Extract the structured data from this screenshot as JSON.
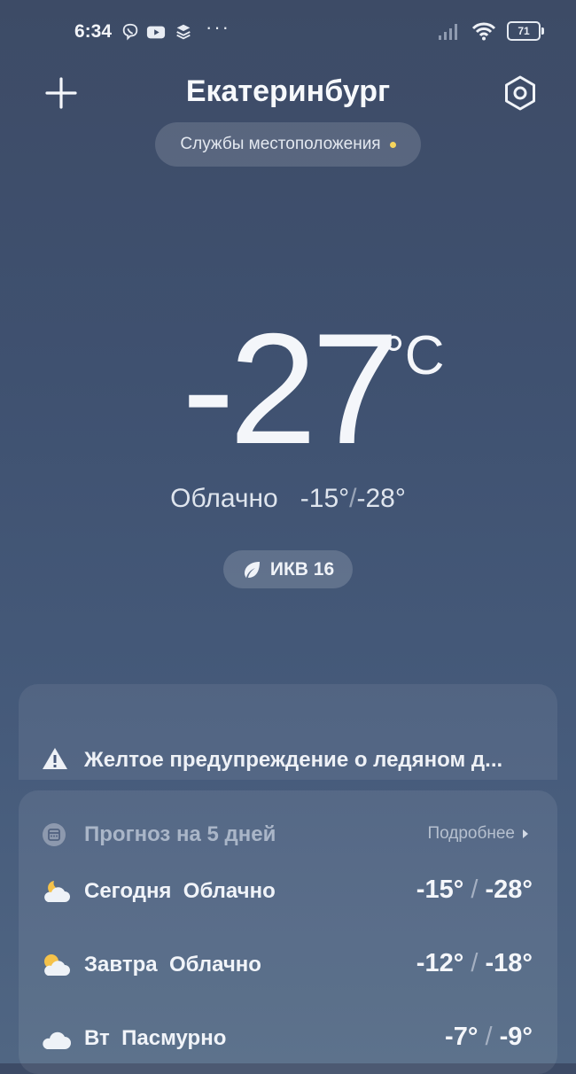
{
  "status_bar": {
    "time": "6:34",
    "battery": "71",
    "more": "···",
    "apps": [
      "viber-icon",
      "youtube-icon",
      "layers-icon"
    ]
  },
  "header": {
    "city": "Екатеринбург",
    "location_services": "Службы местоположения"
  },
  "current": {
    "temperature": "-27",
    "unit": "°C",
    "condition": "Облачно",
    "high": "-15°",
    "low": "-28°",
    "aqi_label": "ИКВ 16"
  },
  "warning": {
    "text": "Желтое предупреждение о ледяном д..."
  },
  "forecast": {
    "title": "Прогноз на 5 дней",
    "more_label": "Подробнее",
    "days": [
      {
        "day": "Сегодня",
        "condition": "Облачно",
        "high": "-15°",
        "low": "-28°",
        "icon": "partly-cloudy-night-icon"
      },
      {
        "day": "Завтра",
        "condition": "Облачно",
        "high": "-12°",
        "low": "-18°",
        "icon": "partly-cloudy-day-icon"
      },
      {
        "day": "Вт",
        "condition": "Пасмурно",
        "high": "-7°",
        "low": "-9°",
        "icon": "cloud-icon"
      }
    ]
  },
  "colors": {
    "accent_dot": "#f6d55c",
    "sun": "#f5c24a"
  }
}
